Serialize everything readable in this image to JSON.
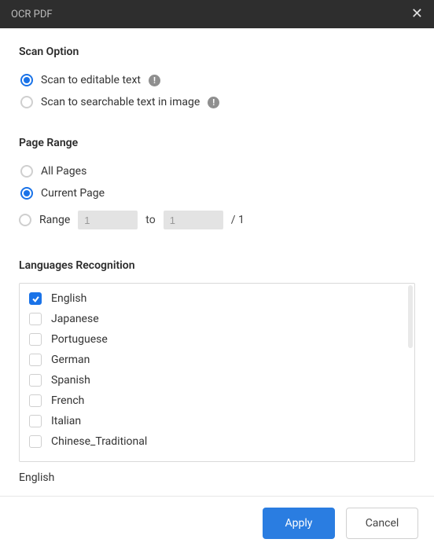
{
  "window": {
    "title": "OCR PDF"
  },
  "scan_option": {
    "title": "Scan Option",
    "items": [
      {
        "label": "Scan to editable text",
        "selected": true,
        "info": true
      },
      {
        "label": "Scan to searchable text in image",
        "selected": false,
        "info": true
      }
    ]
  },
  "page_range": {
    "title": "Page Range",
    "all_label": "All Pages",
    "current_label": "Current Page",
    "range_label": "Range",
    "from_value": "1",
    "to_label": "to",
    "to_value": "1",
    "total_prefix": "/ ",
    "total": "1",
    "selected": "current"
  },
  "languages": {
    "title": "Languages Recognition",
    "items": [
      {
        "name": "English",
        "checked": true
      },
      {
        "name": "Japanese",
        "checked": false
      },
      {
        "name": "Portuguese",
        "checked": false
      },
      {
        "name": "German",
        "checked": false
      },
      {
        "name": "Spanish",
        "checked": false
      },
      {
        "name": "French",
        "checked": false
      },
      {
        "name": "Italian",
        "checked": false
      },
      {
        "name": "Chinese_Traditional",
        "checked": false
      }
    ],
    "selected_summary": "English"
  },
  "footer": {
    "apply": "Apply",
    "cancel": "Cancel"
  }
}
